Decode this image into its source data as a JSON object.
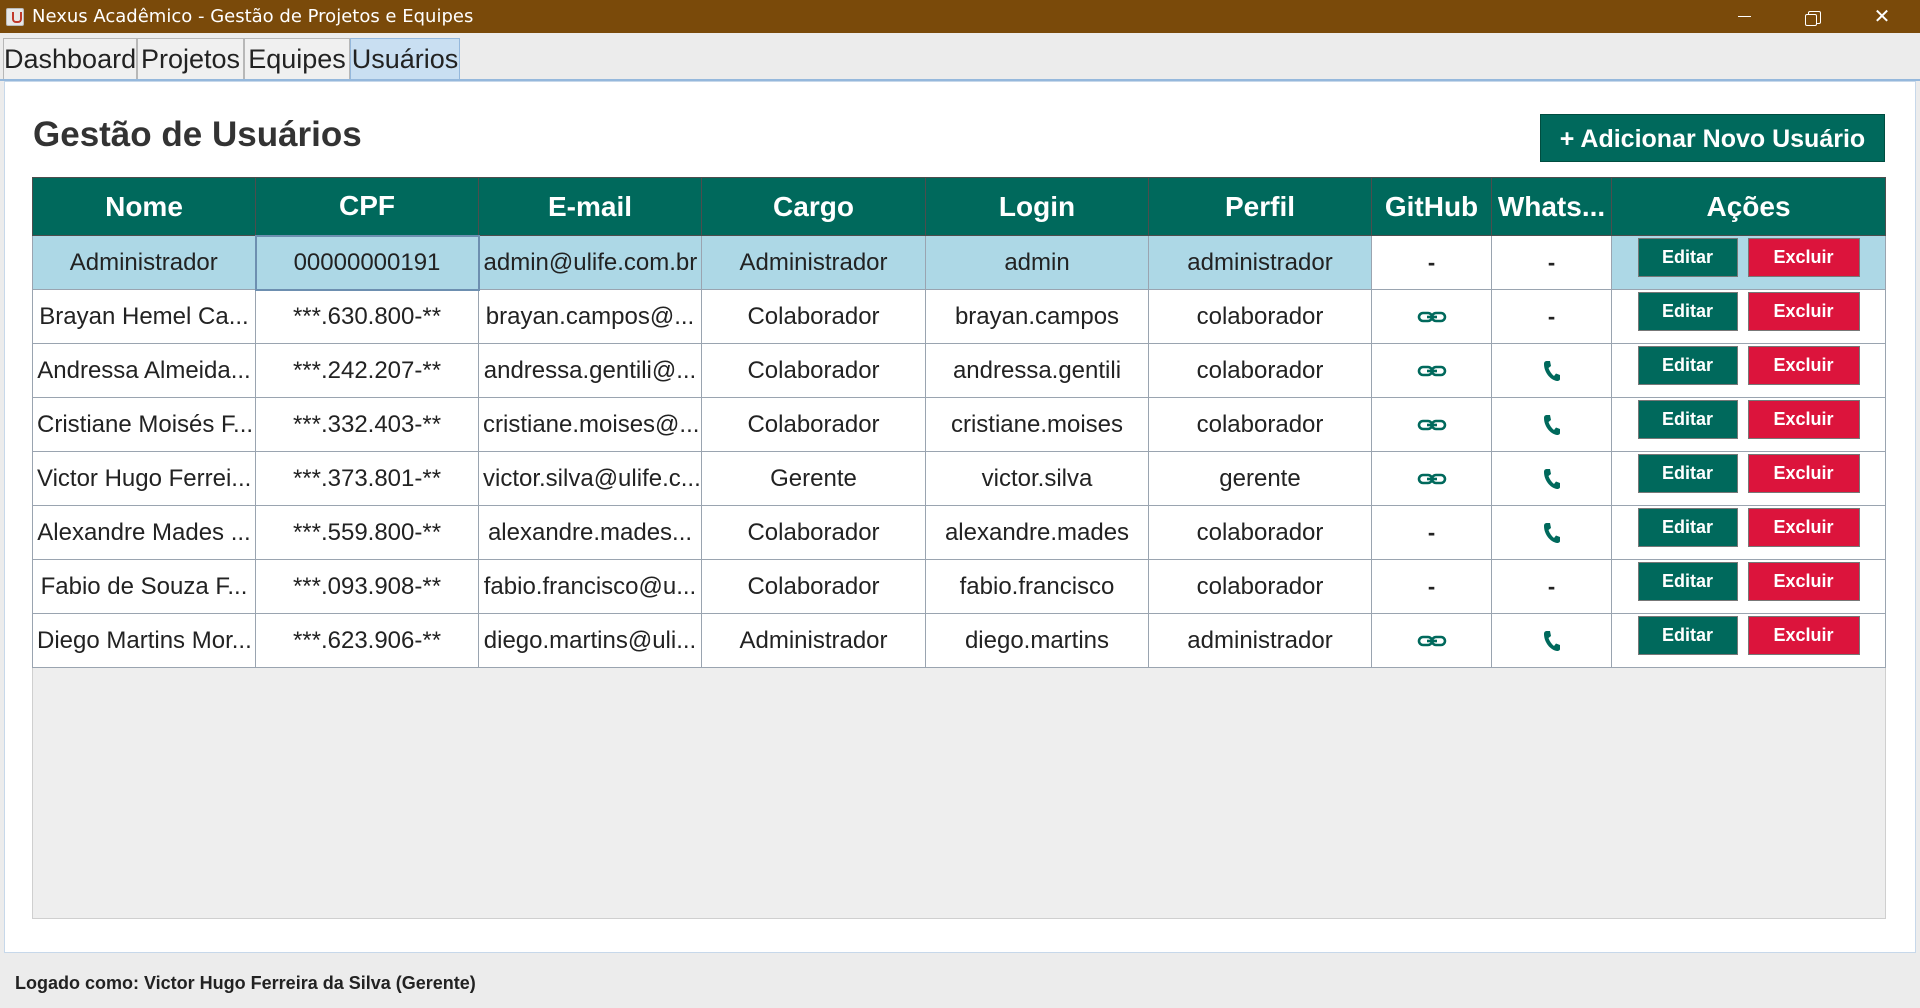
{
  "window": {
    "title": "Nexus Acadêmico - Gestão de Projetos e Equipes"
  },
  "tabs": [
    {
      "label": "Dashboard"
    },
    {
      "label": "Projetos"
    },
    {
      "label": "Equipes"
    },
    {
      "label": "Usuários",
      "active": true
    }
  ],
  "page": {
    "title": "Gestão de Usuários",
    "add_button": "+ Adicionar Novo Usuário"
  },
  "table": {
    "headers": [
      "Nome",
      "CPF",
      "E-mail",
      "Cargo",
      "Login",
      "Perfil",
      "GitHub",
      "Whats...",
      "Ações"
    ],
    "edit_label": "Editar",
    "delete_label": "Excluir",
    "rows": [
      {
        "nome": "Administrador",
        "cpf": "00000000191",
        "email": "admin@ulife.com.br",
        "cargo": "Administrador",
        "login": "admin",
        "perfil": "administrador",
        "github": "-",
        "whats": "-",
        "selected": true
      },
      {
        "nome": "Brayan Hemel Ca...",
        "cpf": "***.630.800-**",
        "email": "brayan.campos@...",
        "cargo": "Colaborador",
        "login": "brayan.campos",
        "perfil": "colaborador",
        "github": "link-icon",
        "whats": "-"
      },
      {
        "nome": "Andressa Almeida...",
        "cpf": "***.242.207-**",
        "email": "andressa.gentili@...",
        "cargo": "Colaborador",
        "login": "andressa.gentili",
        "perfil": "colaborador",
        "github": "link-icon",
        "whats": "phone-icon"
      },
      {
        "nome": "Cristiane Moisés F...",
        "cpf": "***.332.403-**",
        "email": "cristiane.moises@...",
        "cargo": "Colaborador",
        "login": "cristiane.moises",
        "perfil": "colaborador",
        "github": "link-icon",
        "whats": "phone-icon"
      },
      {
        "nome": "Victor Hugo Ferrei...",
        "cpf": "***.373.801-**",
        "email": "victor.silva@ulife.c...",
        "cargo": "Gerente",
        "login": "victor.silva",
        "perfil": "gerente",
        "github": "link-icon",
        "whats": "phone-icon"
      },
      {
        "nome": "Alexandre Mades ...",
        "cpf": "***.559.800-**",
        "email": "alexandre.mades...",
        "cargo": "Colaborador",
        "login": "alexandre.mades",
        "perfil": "colaborador",
        "github": "-",
        "whats": "phone-icon"
      },
      {
        "nome": "Fabio de Souza F...",
        "cpf": "***.093.908-**",
        "email": "fabio.francisco@u...",
        "cargo": "Colaborador",
        "login": "fabio.francisco",
        "perfil": "colaborador",
        "github": "-",
        "whats": "-"
      },
      {
        "nome": "Diego Martins Mor...",
        "cpf": "***.623.906-**",
        "email": "diego.martins@uli...",
        "cargo": "Administrador",
        "login": "diego.martins",
        "perfil": "administrador",
        "github": "link-icon",
        "whats": "phone-icon"
      }
    ]
  },
  "status": {
    "text": "Logado como: Victor Hugo Ferreira da Silva (Gerente)"
  },
  "colors": {
    "accent": "#00695c",
    "danger": "#dc143c",
    "selection": "#add8e6",
    "titlebar": "#7a4a0a"
  }
}
